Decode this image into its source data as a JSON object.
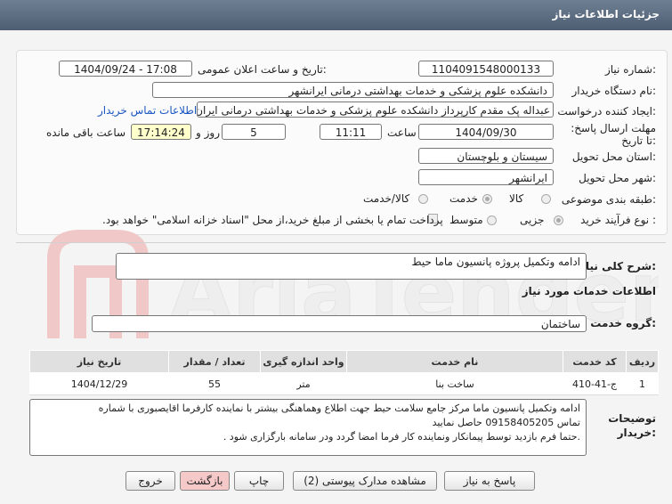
{
  "header": {
    "title": "جزئیات اطلاعات نیاز"
  },
  "fields": {
    "need_number_label": "شماره نیاز:",
    "need_number": "1104091548000133",
    "announce_label": "تاریخ و ساعت اعلان عمومی:",
    "announce_value": "1404/09/24 - 17:08",
    "buyer_org_label": "نام دستگاه خریدار:",
    "buyer_org": "دانشکده علوم پزشکی و خدمات بهداشتی درمانی ایرانشهر",
    "creator_label": "ایجاد کننده درخواست:",
    "creator": "عبداله پک مقدم کارپرداز دانشکده علوم پزشکی و خدمات بهداشتی درمانی ایران",
    "contact_link": "اطلاعات تماس خریدار",
    "deadline_label": "مهلت ارسال پاسخ: تا تاریخ:",
    "deadline_date": "1404/09/30",
    "time_label": "ساعت",
    "deadline_time": "11:11",
    "days_value": "5",
    "days_label": "روز و",
    "remaining_time": "17:14:24",
    "remaining_label": "ساعت باقی مانده",
    "province_label": "استان محل تحویل:",
    "province": "سیستان و بلوچستان",
    "city_label": "شهر محل تحویل:",
    "city": "ایرانشهر",
    "category_label": "طبقه بندی موضوعی:",
    "category_options": [
      "کالا",
      "خدمت",
      "کالا/خدمت"
    ],
    "process_label": "نوع فرآیند خرید :",
    "process_options": [
      "جزیی",
      "متوسط"
    ],
    "payment_note": "پرداخت تمام یا بخشی از مبلغ خرید،از محل \"اسناد خزانه اسلامی\" خواهد بود."
  },
  "summary": {
    "label": "شرح کلی نیاز:",
    "value": "ادامه وتکمیل پروژه پانسیون ماما حیط"
  },
  "services": {
    "title": "اطلاعات خدمات مورد نیاز",
    "group_label": "گروه خدمت:",
    "group_value": "ساختمان",
    "columns": [
      "ردیف",
      "کد خدمت",
      "نام خدمت",
      "واحد اندازه گیری",
      "تعداد / مقدار",
      "تاریخ نیاز"
    ],
    "rows": [
      [
        "1",
        "ج-41-410",
        "ساخت بنا",
        "متر",
        "55",
        "1404/12/29"
      ]
    ]
  },
  "notes": {
    "label": "توضیحات خریدار:",
    "lines": [
      "ادامه وتکمیل پانسیون ماما مرکز جامع سلامت حیط جهت اطلاع وهماهنگی بیشتر با نماینده کارفرما اقایصبوری با شماره",
      "تماس  09158405205 حاصل نمایید",
      ".حتما فرم بازدید توسط پیمانکار ونماینده کار فرما امضا گردد ودر سامانه بارگزاری شود ."
    ]
  },
  "buttons": {
    "reply": "پاسخ به نیاز",
    "docs": "مشاهده مدارک پیوستی (2)",
    "print": "چاپ",
    "back": "بازگشت",
    "exit": "خروج"
  },
  "watermark": {
    "text": "AriaTender.net"
  },
  "colors": {
    "header": "#5b6b80",
    "link": "#1a56c2",
    "back_button": "#f6c9c9"
  }
}
